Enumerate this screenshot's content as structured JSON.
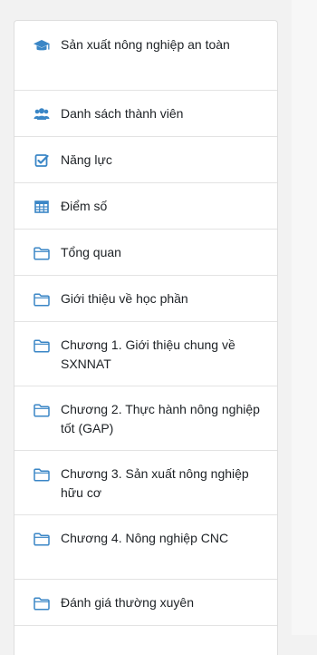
{
  "colors": {
    "icon_blue": "#3a86c6",
    "text": "#1d2125",
    "divider": "#e3e3e3"
  },
  "nav": {
    "items": [
      {
        "label": "Sản xuất nông nghiệp an toàn",
        "icon": "graduation-cap-icon"
      },
      {
        "label": "Danh sách thành viên",
        "icon": "users-icon"
      },
      {
        "label": "Năng lực",
        "icon": "checkbox-icon"
      },
      {
        "label": "Điểm số",
        "icon": "table-icon"
      },
      {
        "label": "Tổng quan",
        "icon": "folder-icon"
      },
      {
        "label": "Giới thiệu về học phần",
        "icon": "folder-icon"
      },
      {
        "label": "Chương 1. Giới thiệu chung về SXNNAT",
        "icon": "folder-icon"
      },
      {
        "label": "Chương 2. Thực hành nông nghiệp tốt (GAP)",
        "icon": "folder-icon"
      },
      {
        "label": "Chương 3. Sản xuất nông nghiệp hữu cơ",
        "icon": "folder-icon"
      },
      {
        "label": "Chương 4. Nông nghiệp CNC",
        "icon": "folder-icon"
      },
      {
        "label": "Đánh giá thường xuyên",
        "icon": "folder-icon"
      }
    ]
  }
}
